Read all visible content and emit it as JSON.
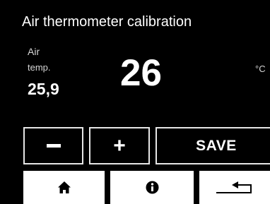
{
  "screen": {
    "title": "Air thermometer calibration"
  },
  "readout": {
    "label_line1": "Air",
    "label_line2": "temp.",
    "value": "25,9"
  },
  "setpoint": {
    "value": "26",
    "unit": "°C"
  },
  "controls": {
    "decrement_icon": "minus-icon",
    "increment_icon": "plus-icon",
    "increment_glyph": "+",
    "save_label": "SAVE"
  },
  "nav": {
    "home_icon": "home-icon",
    "info_icon": "info-icon",
    "back_icon": "back-arrow-icon"
  },
  "colors": {
    "background": "#000000",
    "foreground": "#ffffff",
    "nav_background": "#ffffff",
    "nav_icon": "#000000"
  }
}
